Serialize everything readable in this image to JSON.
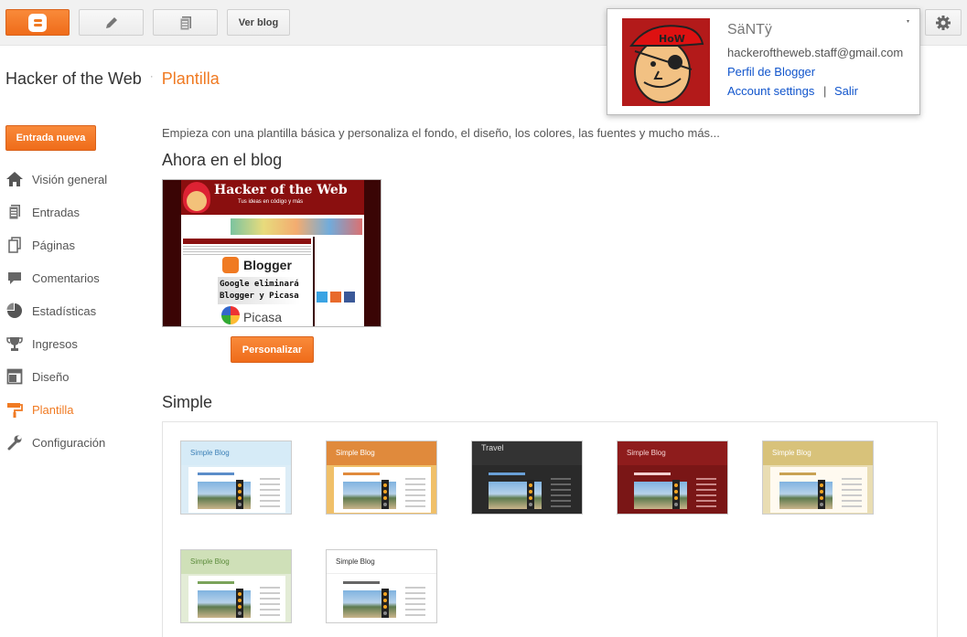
{
  "topbar": {
    "view_blog_label": "Ver blog",
    "buttons": [
      "blogger-logo-icon",
      "pencil-icon",
      "pages-icon"
    ],
    "settings_icon": "gear-icon"
  },
  "header": {
    "blog_name": "Hacker of the Web",
    "separator": "·",
    "page_name": "Plantilla"
  },
  "sidebar": {
    "new_post_label": "Entrada nueva",
    "items": [
      {
        "label": "Visión general",
        "icon": "home-icon"
      },
      {
        "label": "Entradas",
        "icon": "posts-icon"
      },
      {
        "label": "Páginas",
        "icon": "page-icon"
      },
      {
        "label": "Comentarios",
        "icon": "comment-icon"
      },
      {
        "label": "Estadísticas",
        "icon": "pie-chart-icon"
      },
      {
        "label": "Ingresos",
        "icon": "trophy-icon"
      },
      {
        "label": "Diseño",
        "icon": "layout-icon"
      },
      {
        "label": "Plantilla",
        "icon": "paint-roller-icon",
        "active": true
      },
      {
        "label": "Configuración",
        "icon": "wrench-icon"
      }
    ]
  },
  "main": {
    "intro": "Empieza con una plantilla básica y personaliza el fondo, el diseño, los colores, las fuentes y mucho más...",
    "current_heading": "Ahora en el blog",
    "current_preview": {
      "blog_title": "Hacker of the Web",
      "tagline": "Tus ideas en código y más",
      "blogger_label": "Blogger",
      "line1": "Google eliminará",
      "line2": "Blogger y Picasa",
      "picasa_label": "Picasa"
    },
    "personalize_label": "Personalizar",
    "simple_heading": "Simple",
    "templates": [
      {
        "title": "Simple Blog",
        "header_color": "#d6ebf7",
        "bg": "#dcedf7",
        "title_color": "#3b7fb6"
      },
      {
        "title": "Simple Blog",
        "header_color": "#e08a3c",
        "bg": "#f0c069",
        "title_color": "#ffffff"
      },
      {
        "title": "Travel",
        "header_color": "#333333",
        "bg": "#2a2a2a",
        "title_color": "#dddddd"
      },
      {
        "title": "Simple Blog",
        "header_color": "#8e1c1c",
        "bg": "#7a1616",
        "title_color": "#f3d0d0"
      },
      {
        "title": "Simple Blog",
        "header_color": "#d8c27a",
        "bg": "#e9ddb3",
        "title_color": "#ffffff"
      },
      {
        "title": "Simple Blog",
        "header_color": "#cfe0b8",
        "bg": "#e3ecd6",
        "title_color": "#5b8a3a"
      },
      {
        "title": "Simple Blog",
        "header_color": "#ffffff",
        "bg": "#ffffff",
        "title_color": "#333333"
      }
    ]
  },
  "account": {
    "name": "SäNTÿ",
    "email": "hackeroftheweb.staff@gmail.com",
    "profile_link": "Perfil de Blogger",
    "settings_link": "Account settings",
    "pipe": "|",
    "signout_link": "Salir",
    "caret": "▾"
  },
  "colors": {
    "accent": "#f07a22",
    "link": "#1155cc"
  }
}
